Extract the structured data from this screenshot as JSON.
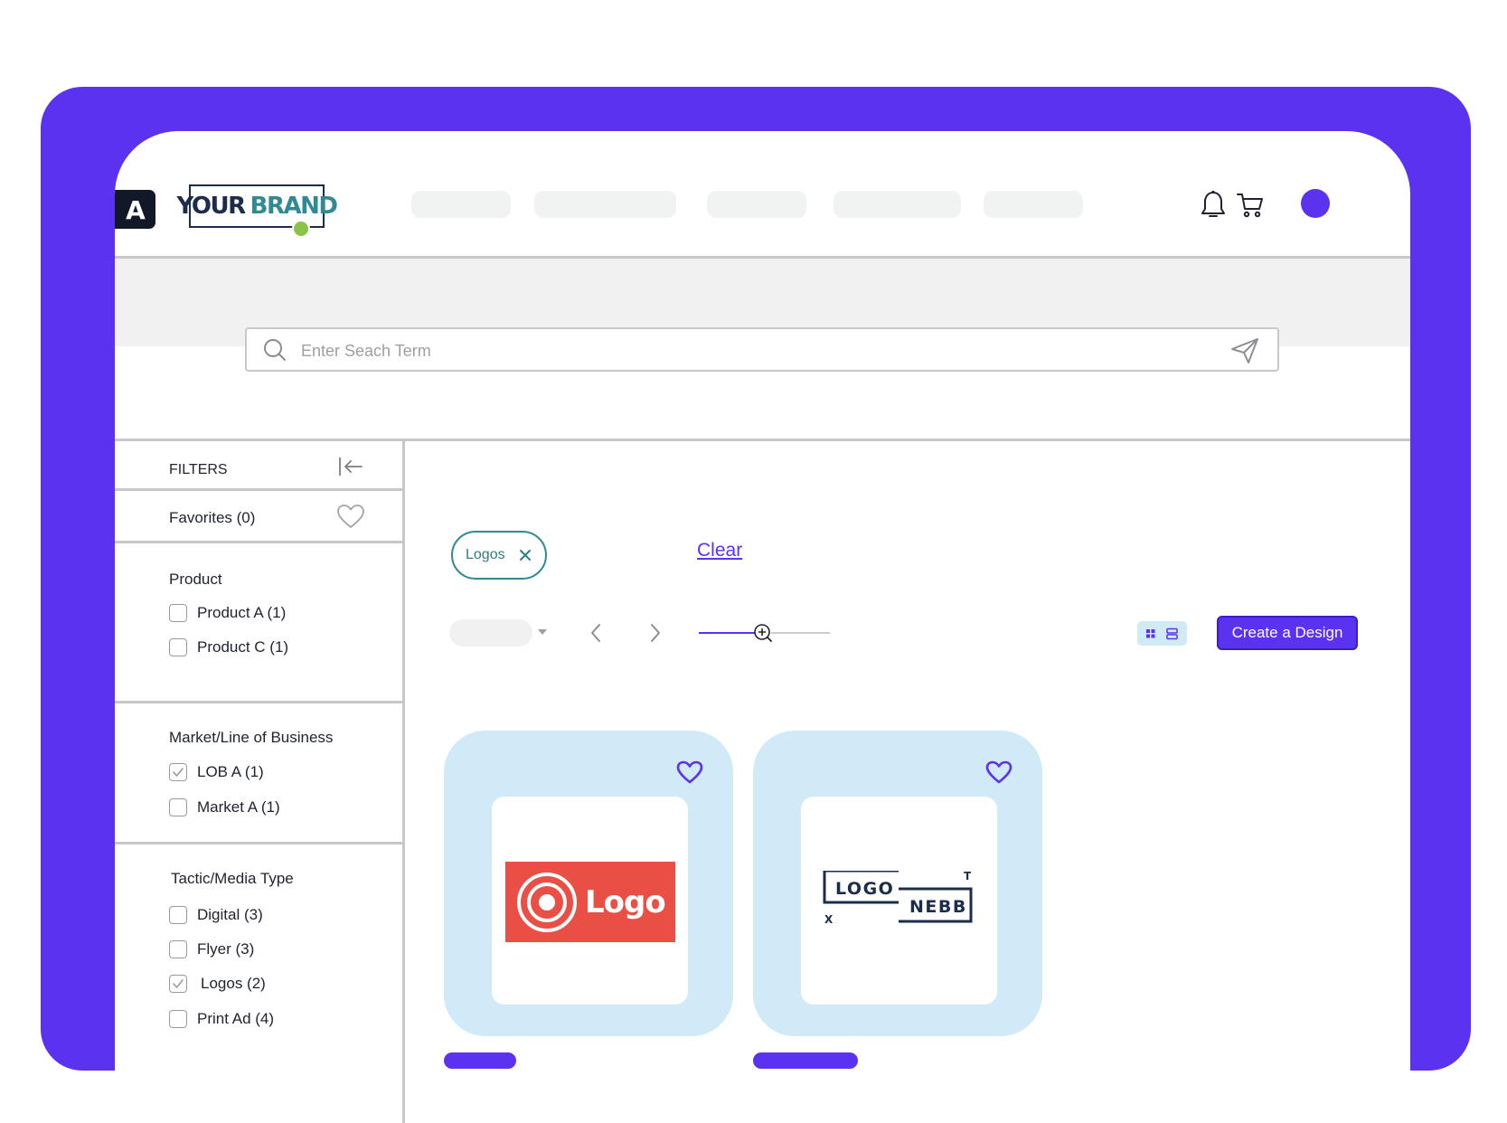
{
  "header": {
    "app_logo_letter": "A",
    "brand": {
      "word1": "YOUR",
      "word2": "BRAND"
    },
    "nav_items": [
      "",
      "",
      "",
      "",
      ""
    ],
    "colors": {
      "accent": "#5b32f0",
      "teal": "#2f8a93",
      "navy": "#1c2c4c"
    }
  },
  "search": {
    "placeholder": "Enter Seach Term",
    "value": ""
  },
  "sidebar": {
    "title": "FILTERS",
    "favorites_label": "Favorites (0)",
    "sections": [
      {
        "title": "Product",
        "options": [
          {
            "label": "Product A (1)",
            "checked": false
          },
          {
            "label": "Product C (1)",
            "checked": false
          }
        ]
      },
      {
        "title": "Market/Line of Business",
        "options": [
          {
            "label": "LOB A (1)",
            "checked": true
          },
          {
            "label": "Market A (1)",
            "checked": false
          }
        ]
      },
      {
        "title": "Tactic/Media Type",
        "options": [
          {
            "label": "Digital (3)",
            "checked": false
          },
          {
            "label": "Flyer (3)",
            "checked": false
          },
          {
            "label": "Logos (2)",
            "checked": true
          },
          {
            "label": "Print Ad (4)",
            "checked": false
          }
        ]
      }
    ]
  },
  "main": {
    "active_filter_chip": "Logos",
    "clear_label": "Clear",
    "create_button_label": "Create a Design",
    "view_mode": "grid",
    "cards": [
      {
        "logo_text": "Logo",
        "favorited": false
      },
      {
        "logo_text_1": "LOGO",
        "logo_text_2": "NEBB",
        "logo_corner_1": "T",
        "logo_corner_2": "X",
        "favorited": false
      }
    ]
  }
}
